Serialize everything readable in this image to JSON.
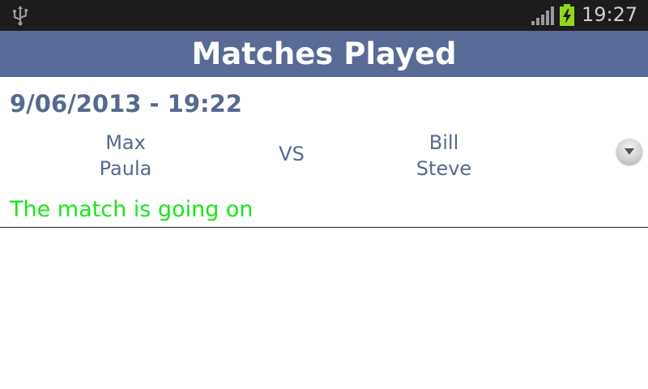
{
  "status_bar": {
    "time": "19:27",
    "icons": [
      "usb-icon",
      "signal-icon",
      "battery-charging-icon"
    ],
    "battery_color": "#8ed81a"
  },
  "title_bar": {
    "title": "Matches Played",
    "background": "#5a6a96"
  },
  "matches": [
    {
      "datetime": "9/06/2013 - 19:22",
      "team_a": [
        "Max",
        "Paula"
      ],
      "vs": "VS",
      "team_b": [
        "Bill",
        "Steve"
      ],
      "status": "The match is going on",
      "status_color": "#19e619",
      "expand_icon": "chevron-down-icon"
    }
  ]
}
